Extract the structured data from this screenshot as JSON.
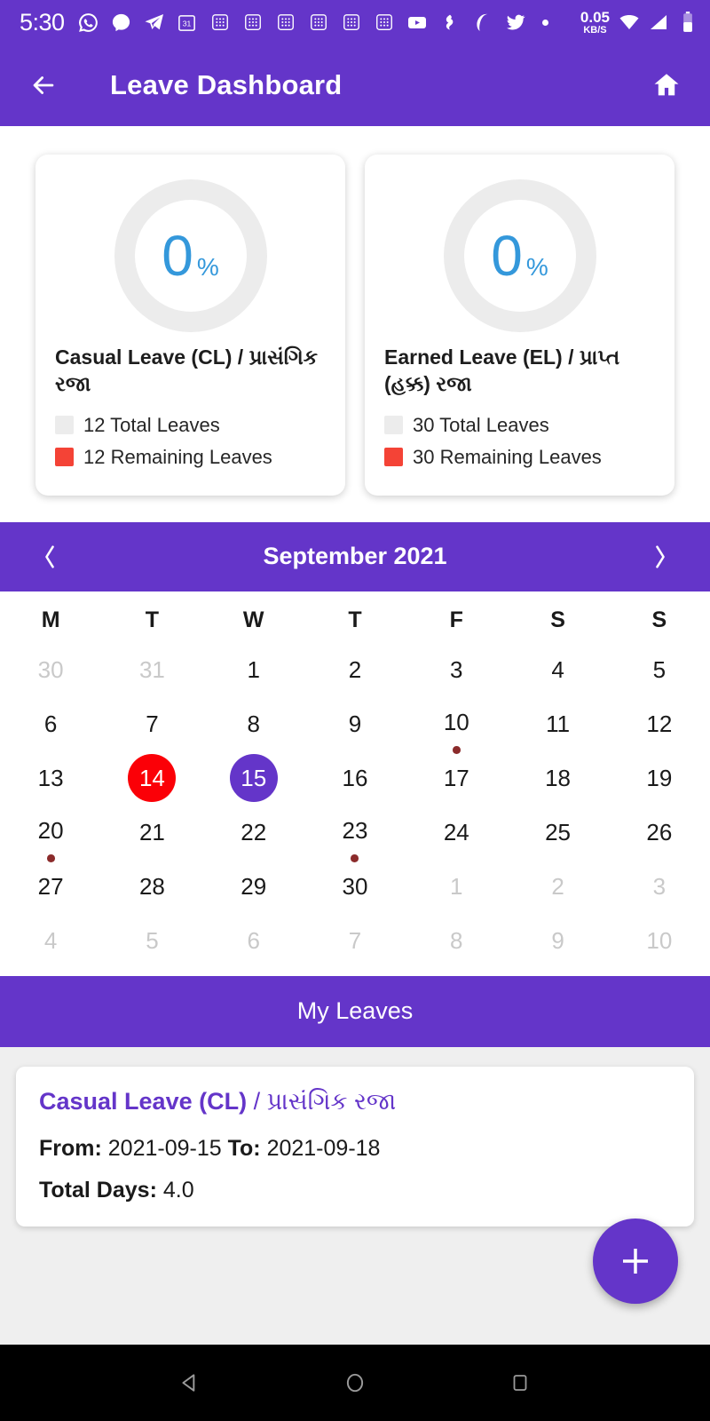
{
  "status_bar": {
    "time": "5:30",
    "icons": [
      "whatsapp-icon",
      "messenger-icon",
      "telegram-icon",
      "calendar-31-icon",
      "keypad-icon",
      "keypad-icon",
      "keypad-icon",
      "keypad-icon",
      "keypad-icon",
      "keypad-icon",
      "youtube-icon",
      "snapseed-icon",
      "opera-icon",
      "twitter-icon"
    ],
    "separator": "dot",
    "net_speed_value": "0.05",
    "net_speed_unit": "KB/S",
    "right_icons": [
      "wifi-icon",
      "signal-icon",
      "battery-icon"
    ]
  },
  "app_bar": {
    "back_icon": "arrow-left-icon",
    "title": "Leave Dashboard",
    "home_icon": "home-icon"
  },
  "leave_cards": [
    {
      "percent": "0",
      "percent_symbol": "%",
      "title": "Casual Leave (CL) / પ્રાસંગિક રજા",
      "total_label": "12 Total Leaves",
      "remaining_label": "12 Remaining Leaves",
      "total_color": "#ececec",
      "remaining_color": "#f44336"
    },
    {
      "percent": "0",
      "percent_symbol": "%",
      "title": "Earned Leave (EL) / પ્રાપ્ત (હક્ક) રજા",
      "total_label": "30 Total Leaves",
      "remaining_label": "30 Remaining Leaves",
      "total_color": "#ececec",
      "remaining_color": "#f44336"
    }
  ],
  "calendar": {
    "prev_icon": "chevron-left-icon",
    "next_icon": "chevron-right-icon",
    "month_title": "September 2021",
    "day_headers": [
      "M",
      "T",
      "W",
      "T",
      "F",
      "S",
      "S"
    ],
    "weeks": [
      [
        {
          "d": "30",
          "out": true
        },
        {
          "d": "31",
          "out": true
        },
        {
          "d": "1"
        },
        {
          "d": "2"
        },
        {
          "d": "3"
        },
        {
          "d": "4"
        },
        {
          "d": "5"
        }
      ],
      [
        {
          "d": "6"
        },
        {
          "d": "7"
        },
        {
          "d": "8"
        },
        {
          "d": "9"
        },
        {
          "d": "10",
          "dot": true
        },
        {
          "d": "11"
        },
        {
          "d": "12"
        }
      ],
      [
        {
          "d": "13"
        },
        {
          "d": "14",
          "today": true
        },
        {
          "d": "15",
          "selected": true
        },
        {
          "d": "16"
        },
        {
          "d": "17"
        },
        {
          "d": "18"
        },
        {
          "d": "19"
        }
      ],
      [
        {
          "d": "20",
          "dot": true
        },
        {
          "d": "21"
        },
        {
          "d": "22"
        },
        {
          "d": "23",
          "dot": true
        },
        {
          "d": "24"
        },
        {
          "d": "25"
        },
        {
          "d": "26"
        }
      ],
      [
        {
          "d": "27"
        },
        {
          "d": "28"
        },
        {
          "d": "29"
        },
        {
          "d": "30"
        },
        {
          "d": "1",
          "out": true
        },
        {
          "d": "2",
          "out": true
        },
        {
          "d": "3",
          "out": true
        }
      ],
      [
        {
          "d": "4",
          "out": true
        },
        {
          "d": "5",
          "out": true
        },
        {
          "d": "6",
          "out": true
        },
        {
          "d": "7",
          "out": true
        },
        {
          "d": "8",
          "out": true
        },
        {
          "d": "9",
          "out": true
        },
        {
          "d": "10",
          "out": true
        }
      ]
    ]
  },
  "my_leaves": {
    "section_title": "My Leaves",
    "items": [
      {
        "type_en": "Casual Leave (CL)",
        "type_sep": " / ",
        "type_local": "પ્રાસંગિક રજા",
        "from_label": "From:",
        "from_value": " 2021-09-15 ",
        "to_label": "To:",
        "to_value": " 2021-09-18",
        "days_label": "Total Days:",
        "days_value": " 4.0"
      }
    ],
    "fab_icon": "plus-icon"
  },
  "nav_bar": {
    "back_icon": "triangle-back-icon",
    "home_icon": "circle-home-icon",
    "recents_icon": "square-recents-icon"
  },
  "colors": {
    "primary": "#6435c9",
    "accent_blue": "#3498db",
    "today_red": "#fb0007",
    "event_dot": "#8b2b2b"
  }
}
